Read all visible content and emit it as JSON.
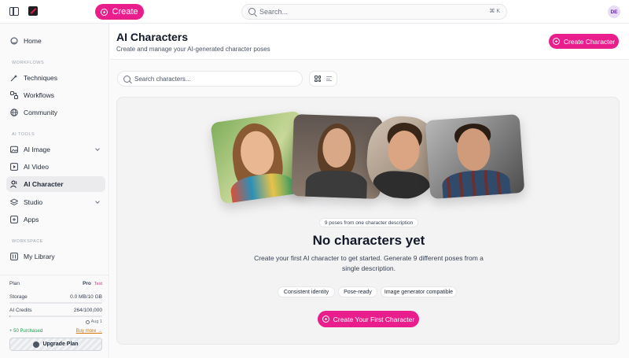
{
  "topbar": {
    "create_label": "Create",
    "search_placeholder": "Search...",
    "search_shortcut": "⌘ K",
    "avatar_initials": "DE"
  },
  "sidebar": {
    "home": "Home",
    "workflows_section": "WORKFLOWS",
    "techniques": "Techniques",
    "workflows": "Workflows",
    "community": "Community",
    "ai_tools_section": "AI TOOLS",
    "ai_image": "AI Image",
    "ai_video": "AI Video",
    "ai_character": "AI Character",
    "studio": "Studio",
    "apps": "Apps",
    "workspace_section": "WORKSPACE",
    "my_library": "My Library"
  },
  "plan": {
    "plan_label": "Plan",
    "plan_value": "Pro",
    "plan_badge": "Test",
    "storage_label": "Storage",
    "storage_value": "0.0 MB/10 GB",
    "storage_fraction": 0.0,
    "credits_label": "AI Credits",
    "credits_value": "264/100,000",
    "credits_fraction": 0.003,
    "renew_date": "Aug 1",
    "purchased": "+ 50 Purchased",
    "buy_more": "Buy more →",
    "upgrade_label": "Upgrade Plan"
  },
  "main": {
    "title": "AI Characters",
    "subtitle": "Create and manage your AI-generated character poses",
    "create_character": "Create Character",
    "search_placeholder": "Search characters...",
    "poses_pill": "9 poses from one character description",
    "empty_title": "No characters yet",
    "empty_desc": "Create your first AI character to get started. Generate 9 different poses from a single description.",
    "tags": [
      "Consistent identity",
      "Pose-ready",
      "Image generator compatible"
    ],
    "first_button": "Create Your First Character"
  },
  "colors": {
    "accent": "#e91e8c"
  }
}
